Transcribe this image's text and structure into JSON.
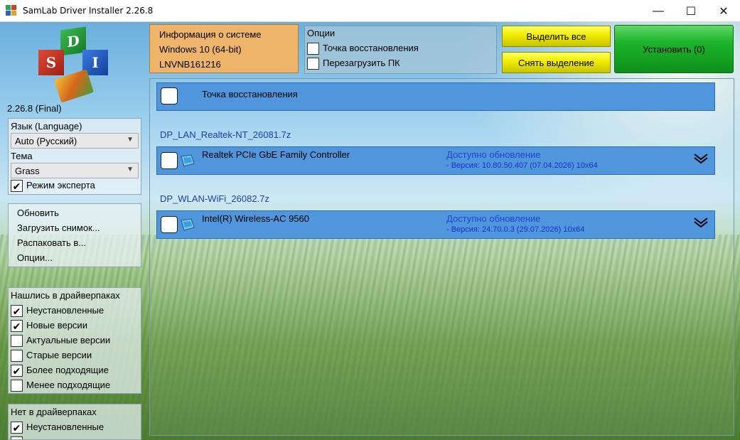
{
  "window": {
    "title": "SamLab Driver Installer 2.26.8",
    "minimize": "—",
    "maximize": "☐",
    "close": "✕"
  },
  "logo": {
    "letters": [
      "D",
      "S",
      "I"
    ]
  },
  "sidebar": {
    "version": "2.26.8 (Final)",
    "language_label": "Язык (Language)",
    "language_value": "Auto (Русский)",
    "theme_label": "Тема",
    "theme_value": "Grass",
    "expert_mode": {
      "label": "Режим эксперта",
      "checked": true
    },
    "menu": [
      "Обновить",
      "Загрузить снимок...",
      "Распаковать в...",
      "Опции..."
    ],
    "found_title": "Нашлись в драйверпаках",
    "found_filters": [
      {
        "label": "Неустановленные",
        "checked": true
      },
      {
        "label": "Новые версии",
        "checked": true
      },
      {
        "label": "Актуальные версии",
        "checked": false
      },
      {
        "label": "Старые версии",
        "checked": false
      },
      {
        "label": "Более подходящие",
        "checked": true
      },
      {
        "label": "Менее подходящие",
        "checked": false
      }
    ],
    "notfound_title": "Нет в драйверпаках",
    "notfound_filters": [
      {
        "label": "Неустановленные",
        "checked": true
      }
    ]
  },
  "system_info": {
    "title": "Информация о системе",
    "os": "Windows 10 (64-bit)",
    "computer": "LNVNB161216"
  },
  "options": {
    "title": "Опции",
    "restore_point": "Точка восстановления",
    "reboot": "Перезагрузить ПК"
  },
  "buttons": {
    "select_all": "Выделить все",
    "deselect": "Снять выделение",
    "install": "Установить (0)"
  },
  "restore_row": {
    "label": "Точка восстановления"
  },
  "driver_packs": [
    {
      "pack": "DP_LAN_Realtek-NT_26081.7z",
      "device": "Realtek PCIe GbE Family Controller",
      "status": "Доступно обновление",
      "version": "- Версия: 10.80.50.407 (07.04.2026) 10x64"
    },
    {
      "pack": "DP_WLAN-WiFi_26082.7z",
      "device": "Intel(R) Wireless-AC 9560",
      "status": "Доступно обновление",
      "version": "- Версия: 24.70.0.3 (29.07.2026) 10x64"
    }
  ],
  "icons": {
    "checkmark": "✔",
    "dropdown": "▼",
    "expand": "⌄⌄"
  },
  "colors": {
    "info_bg": "#eeb46a",
    "row_bg": "#4f96dc",
    "install_green": "#1eb42c",
    "button_yellow": "#f0ec00",
    "link_blue": "#1a3fb0"
  }
}
